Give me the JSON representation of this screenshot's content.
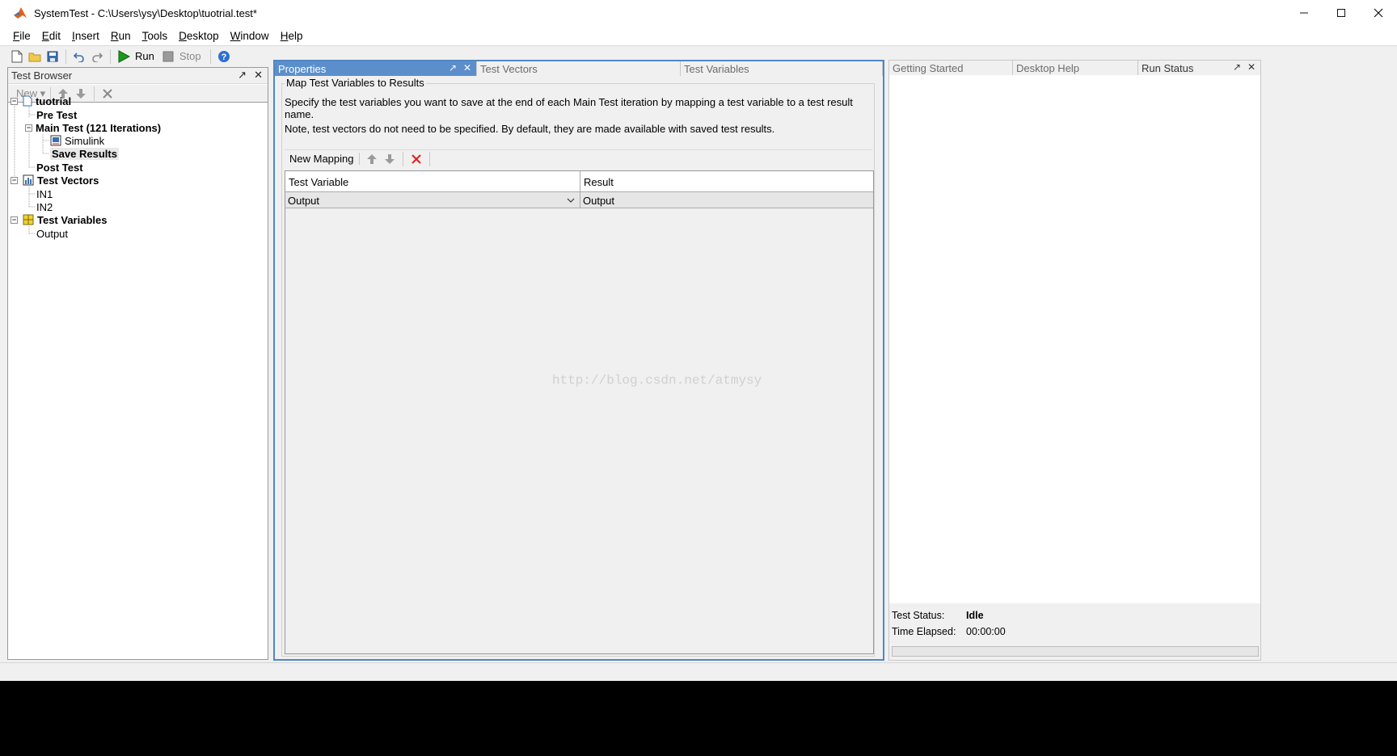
{
  "window": {
    "title": "SystemTest - C:\\Users\\ysy\\Desktop\\tuotrial.test*",
    "controls": [
      "minimize-icon",
      "maximize-icon",
      "close-icon"
    ]
  },
  "menu": [
    {
      "m": "F",
      "rest": "ile"
    },
    {
      "m": "E",
      "rest": "dit"
    },
    {
      "m": "I",
      "rest": "nsert"
    },
    {
      "m": "R",
      "rest": "un"
    },
    {
      "m": "T",
      "rest": "ools"
    },
    {
      "m": "D",
      "rest": "esktop"
    },
    {
      "m": "W",
      "rest": "indow"
    },
    {
      "m": "H",
      "rest": "elp"
    }
  ],
  "toolbar": {
    "run_label": "Run",
    "stop_label": "Stop",
    "icons": [
      "new-file-icon",
      "open-folder-icon",
      "save-icon",
      "undo-icon",
      "redo-icon",
      "run-icon",
      "stop-icon",
      "help-icon"
    ]
  },
  "browser": {
    "title": "Test Browser",
    "new_label": "New",
    "tree": [
      {
        "label": "tuotrial",
        "bold": true
      },
      {
        "label": "Pre Test",
        "bold": true
      },
      {
        "label": "Main Test (121 Iterations)",
        "bold": true
      },
      {
        "label": "Simulink",
        "bold": false
      },
      {
        "label": "Save Results",
        "bold": true,
        "selected": true
      },
      {
        "label": "Post Test",
        "bold": true
      },
      {
        "label": "Test Vectors",
        "bold": true
      },
      {
        "label": "IN1",
        "bold": false
      },
      {
        "label": "IN2",
        "bold": false
      },
      {
        "label": "Test Variables",
        "bold": true
      },
      {
        "label": "Output",
        "bold": false
      }
    ]
  },
  "center": {
    "tabs": [
      "Properties",
      "Test Vectors",
      "Test Variables"
    ],
    "active_tab": "Properties",
    "group_title": "Map Test Variables to Results",
    "desc1": "Specify the test variables you want to save at the end of each Main Test iteration by mapping a test variable to a test result name.",
    "desc2": "Note, test vectors do not need to be specified. By default, they are made available with saved test results.",
    "new_mapping_label": "New Mapping",
    "table": {
      "headers": [
        "Test Variable",
        "Result"
      ],
      "rows": [
        {
          "test_variable": "Output",
          "result": "Output"
        }
      ]
    },
    "watermark": "http://blog.csdn.net/atmysy"
  },
  "right": {
    "tabs": [
      "Getting Started",
      "Desktop Help",
      "Run Status"
    ],
    "active_tab": "Run Status",
    "status_label": "Test Status:",
    "status_value": "Idle",
    "elapsed_label": "Time Elapsed:",
    "elapsed_value": "00:00:00",
    "progress": 0
  },
  "colors": {
    "accent": "#5b8fcc",
    "focus_border": "#4f88c8",
    "run_green": "#1a9c1a",
    "delete_red": "#e02020",
    "matlab_orange": "#e0631a"
  }
}
